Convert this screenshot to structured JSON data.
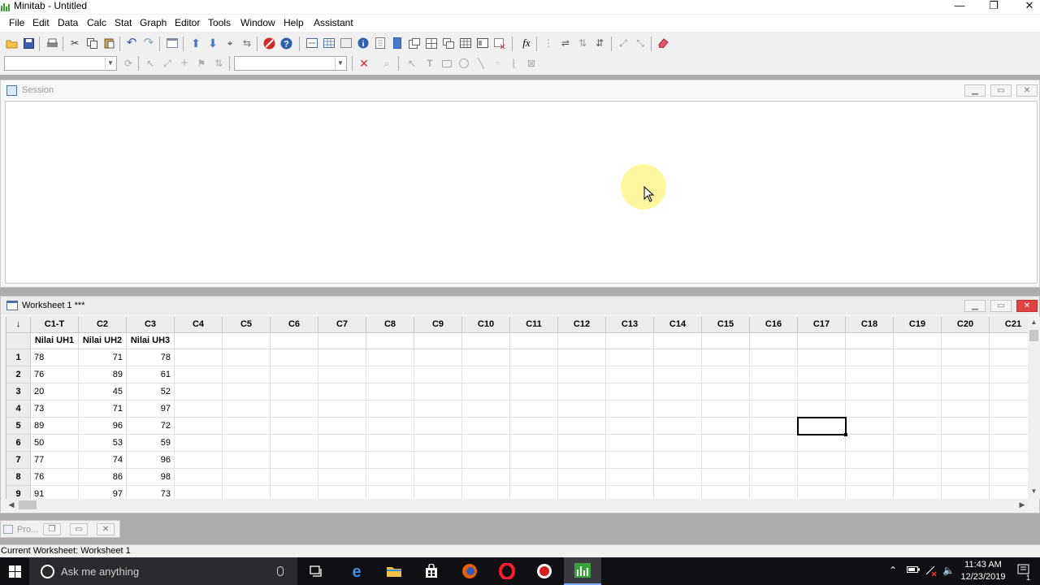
{
  "window": {
    "title": "Minitab - Untitled",
    "minimize": "—",
    "restore": "❐",
    "close": "✕"
  },
  "menu": [
    "File",
    "Edit",
    "Data",
    "Calc",
    "Stat",
    "Graph",
    "Editor",
    "Tools",
    "Window",
    "Help",
    "Assistant"
  ],
  "session": {
    "title": "Session"
  },
  "worksheet": {
    "title": "Worksheet 1 ***",
    "row_header_symbol": "↓",
    "columns": [
      "C1-T",
      "C2",
      "C3",
      "C4",
      "C5",
      "C6",
      "C7",
      "C8",
      "C9",
      "C10",
      "C11",
      "C12",
      "C13",
      "C14",
      "C15",
      "C16",
      "C17",
      "C18",
      "C19",
      "C20",
      "C21"
    ],
    "column_names": [
      "Nilai UH1",
      "Nilai UH2",
      "Nilai UH3"
    ],
    "rows": [
      {
        "n": "1",
        "c1": "78",
        "c2": "71",
        "c3": "78"
      },
      {
        "n": "2",
        "c1": "76",
        "c2": "89",
        "c3": "61"
      },
      {
        "n": "3",
        "c1": "20",
        "c2": "45",
        "c3": "52"
      },
      {
        "n": "4",
        "c1": "73",
        "c2": "71",
        "c3": "97"
      },
      {
        "n": "5",
        "c1": "89",
        "c2": "96",
        "c3": "72"
      },
      {
        "n": "6",
        "c1": "50",
        "c2": "53",
        "c3": "59"
      },
      {
        "n": "7",
        "c1": "77",
        "c2": "74",
        "c3": "96"
      },
      {
        "n": "8",
        "c1": "76",
        "c2": "86",
        "c3": "98"
      },
      {
        "n": "9",
        "c1": "91",
        "c2": "97",
        "c3": "73"
      }
    ],
    "active_cell": {
      "column": "C17",
      "row": "5"
    }
  },
  "project_window": {
    "title": "Pro..."
  },
  "status": {
    "text": "Current Worksheet: Worksheet 1"
  },
  "taskbar": {
    "search_placeholder": "Ask me anything",
    "time": "11:43 AM",
    "date": "12/23/2019",
    "notification_count": "1"
  },
  "colors": {
    "accent_blue": "#2f6fce",
    "close_red": "#e04343",
    "cursor_highlight": "#fff050",
    "taskbar": "#101014"
  }
}
